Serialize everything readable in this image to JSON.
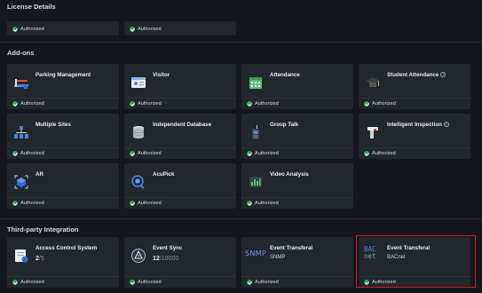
{
  "license": {
    "title": "License Details",
    "cards": [
      {
        "status": "Authorized"
      },
      {
        "status": "Authorized"
      }
    ]
  },
  "addons": {
    "title": "Add-ons",
    "cards": [
      {
        "name": "Parking Management",
        "icon": "parking-icon",
        "status": "Authorized"
      },
      {
        "name": "Visitor",
        "icon": "visitor-card-icon",
        "status": "Authorized"
      },
      {
        "name": "Attendance",
        "icon": "calendar-icon",
        "status": "Authorized"
      },
      {
        "name": "Student Attendance",
        "icon": "graduation-cap-icon",
        "status": "Authorized",
        "info": "i"
      },
      {
        "name": "Multiple Sites",
        "icon": "sites-network-icon",
        "status": "Authorized"
      },
      {
        "name": "Independent Database",
        "icon": "database-icon",
        "status": "Authorized"
      },
      {
        "name": "Group Talk",
        "icon": "walkie-talkie-icon",
        "status": "Authorized"
      },
      {
        "name": "Intelligent Inspection",
        "icon": "inspection-icon",
        "status": "Authorized",
        "info": "i"
      },
      {
        "name": "AR",
        "icon": "ar-icon",
        "status": "Authorized"
      },
      {
        "name": "AcuPick",
        "icon": "search-icon",
        "status": "Authorized"
      },
      {
        "name": "Video Analysis",
        "icon": "video-analysis-icon",
        "status": "Authorized"
      }
    ]
  },
  "thirdparty": {
    "title": "Third-party Integration",
    "cards": [
      {
        "name": "Access Control System",
        "icon": "access-control-icon",
        "value": "2",
        "value_total": "/5",
        "status": "Authorized"
      },
      {
        "name": "Event Sync",
        "icon": "event-sync-icon",
        "value": "12",
        "value_total": "/10000",
        "status": "Authorized"
      },
      {
        "name": "Event Transferal",
        "icon": "snmp-icon",
        "icon_text": "SNMP",
        "sub": "SNMP",
        "status": "Authorized"
      },
      {
        "name": "Event Transferal",
        "icon": "bacnet-icon",
        "icon_text1": "BAC",
        "icon_text2": "net",
        "sub": "BACnet",
        "status": "Authorized"
      }
    ]
  },
  "colors": {
    "background": "#14171c",
    "card": "#22262d",
    "authorized": "#3aa655",
    "highlight": "#d01a24",
    "accent_blue": "#2b6fd6"
  }
}
